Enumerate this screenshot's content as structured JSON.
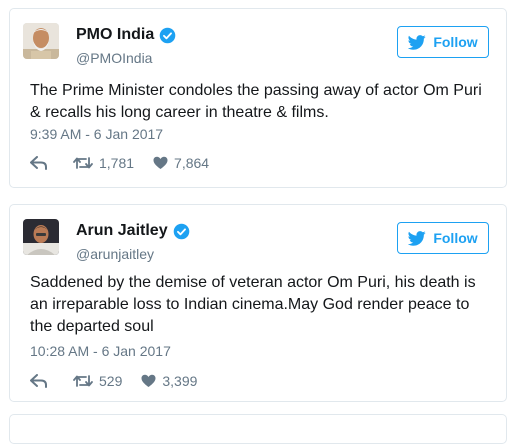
{
  "tweets": [
    {
      "name": "PMO India",
      "handle": "@PMOIndia",
      "follow_label": "Follow",
      "text": "The Prime Minister condoles the passing away of actor Om Puri & recalls his long career in theatre & films.",
      "time": "9:39 AM - 6 Jan 2017",
      "retweets": "1,781",
      "likes": "7,864"
    },
    {
      "name": "Arun Jaitley",
      "handle": "@arunjaitley",
      "follow_label": "Follow",
      "text": "Saddened by the demise of veteran actor Om Puri, his death is an irreparable loss to Indian cinema.May God render peace to the departed soul",
      "time": "10:28 AM - 6 Jan 2017",
      "retweets": "529",
      "likes": "3,399"
    }
  ],
  "colors": {
    "accent": "#1da1f2",
    "muted": "#657786",
    "border": "#e1e8ed"
  }
}
